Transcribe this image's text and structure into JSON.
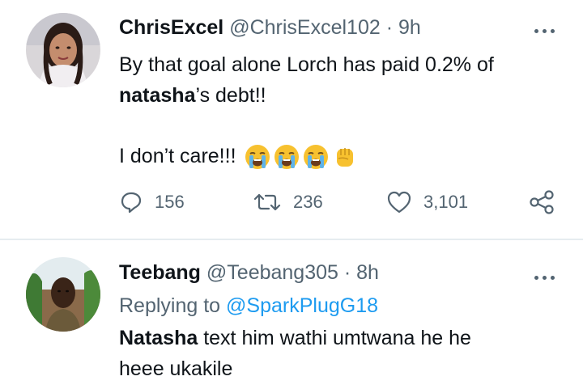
{
  "tweets": [
    {
      "name": "ChrisExcel",
      "handle": "@ChrisExcel102",
      "separator": "·",
      "time": "9h",
      "text": {
        "line1": "By that goal alone Lorch has paid 0.2% of",
        "line2_bold": "natasha",
        "line2_rest": "’s debt!!",
        "line3": "I don’t care!!!"
      },
      "emojis": [
        "loudly-crying-face",
        "loudly-crying-face",
        "loudly-crying-face",
        "raised-fist"
      ],
      "stats": {
        "replies": "156",
        "retweets": "236",
        "likes": "3,101"
      }
    },
    {
      "name": "Teebang",
      "handle": "@Teebang305",
      "separator": "·",
      "time": "8h",
      "replying_label": "Replying to",
      "replying_to": "@SparkPlugG18",
      "text": {
        "line1_bold": "Natasha",
        "line1_rest": " text him wathi umtwana he he",
        "line2": "heee ukakile"
      }
    }
  ],
  "colors": {
    "text_primary": "#0f1419",
    "text_secondary": "#536471",
    "link": "#1d9bf0",
    "divider": "#e6ecf0"
  }
}
